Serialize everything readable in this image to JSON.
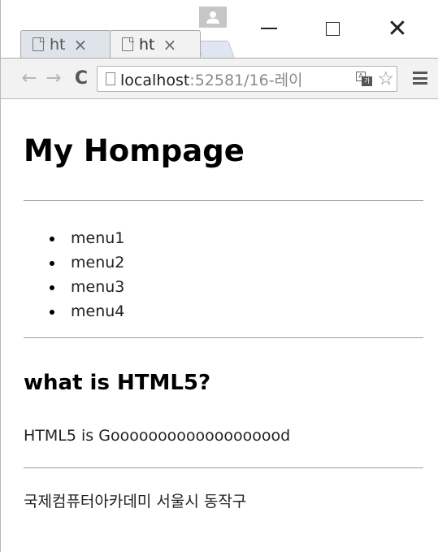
{
  "tabs": [
    {
      "label": "ht",
      "close": "×",
      "active": false
    },
    {
      "label": "ht",
      "close": "×",
      "active": true
    }
  ],
  "window_controls": {
    "minimize": "",
    "maximize": "",
    "close": "✕"
  },
  "toolbar": {
    "back": "←",
    "forward": "→",
    "reload": "C",
    "url_host": "localhost",
    "url_rest": ":52581/16-레이",
    "star": "☆"
  },
  "page": {
    "title": "My Hompage",
    "menu": [
      "menu1",
      "menu2",
      "menu3",
      "menu4"
    ],
    "section_title": "what is HTML5?",
    "section_body": "HTML5 is Gooooooooooooooooood",
    "footer": "국제컴퓨터아카데미 서울시 동작구"
  },
  "colors": {
    "rule": "#9e9e9e",
    "toolbar_bg": "#f2f2f2",
    "text": "#000000"
  }
}
